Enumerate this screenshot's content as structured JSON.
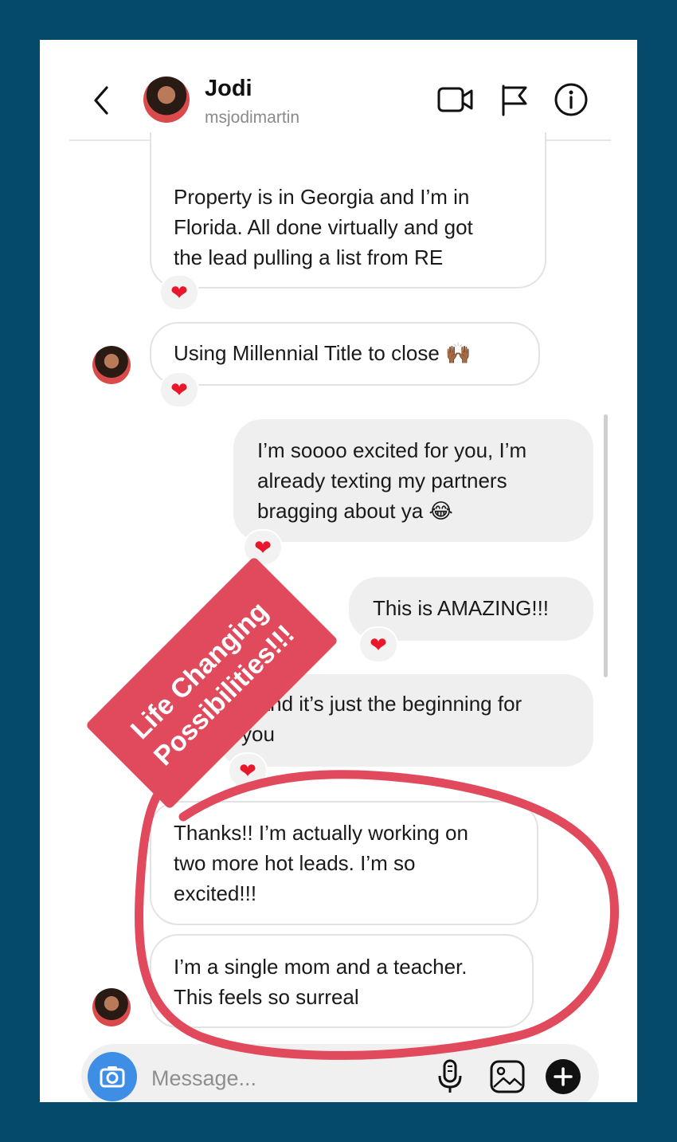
{
  "header": {
    "name": "Jodi",
    "handle": "msjodimartin"
  },
  "messages": {
    "m1": {
      "line1": "Property is in Georgia and I’m in",
      "line2": "Florida. All done virtually and got",
      "line3": "the lead pulling a list from RE"
    },
    "m2": {
      "text": "Using Millennial Title to close 🙌🏾"
    },
    "m3": {
      "line1": "I’m soooo excited for you, I’m",
      "line2": "already texting my partners",
      "line3": "bragging about ya 😂"
    },
    "m4": {
      "text": "This is AMAZING!!!"
    },
    "m5": {
      "line1": "...and it’s just the beginning for",
      "line2": "you"
    },
    "m6": {
      "line1": "Thanks!! I’m actually working on",
      "line2": "two more hot leads. I’m so",
      "line3": "excited!!!"
    },
    "m7": {
      "line1": "I’m a single mom and a teacher.",
      "line2": "This feels so surreal"
    }
  },
  "reaction": "❤",
  "composer": {
    "placeholder": "Message..."
  },
  "overlay": {
    "line1": "Life Changing",
    "line2": "Possibilities!!!"
  },
  "colors": {
    "accent": "#e04a5c",
    "camera": "#3f8ee6",
    "heart": "#e8172b",
    "frame": "#054a6b"
  },
  "icons": [
    "back-arrow-icon",
    "video-call-icon",
    "flag-icon",
    "info-icon",
    "camera-icon",
    "microphone-icon",
    "gallery-icon",
    "plus-icon",
    "heart-icon"
  ]
}
